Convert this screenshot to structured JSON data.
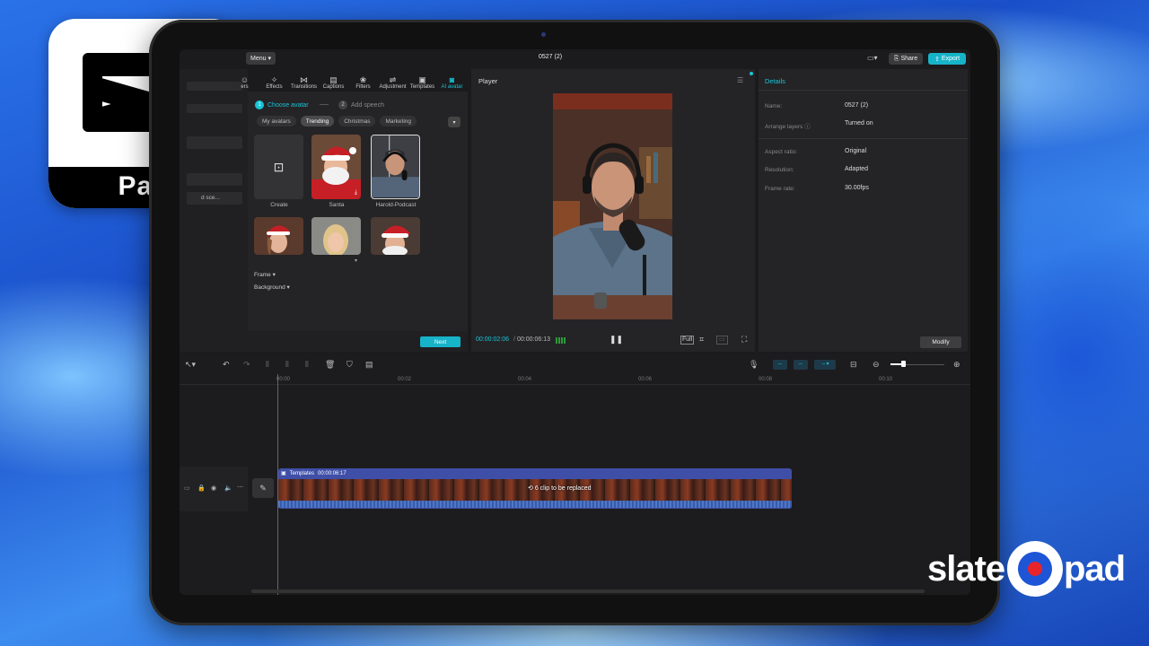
{
  "overlay": {
    "capcut_badge_text": "Pad",
    "brand_left": "slate",
    "brand_right": "pad"
  },
  "topbar": {
    "menu_label": "Menu",
    "project_title": "0527 (2)",
    "share_label": "Share",
    "export_label": "Export"
  },
  "left_nav": {
    "partial_item": "d sce..."
  },
  "toolbar": {
    "items": [
      {
        "label": "ers",
        "icon": "stickers-icon"
      },
      {
        "label": "Effects",
        "icon": "effects-icon"
      },
      {
        "label": "Transitions",
        "icon": "transitions-icon"
      },
      {
        "label": "Captions",
        "icon": "captions-icon"
      },
      {
        "label": "Filters",
        "icon": "filters-icon"
      },
      {
        "label": "Adjustment",
        "icon": "adjustment-icon"
      },
      {
        "label": "Templates",
        "icon": "templates-icon"
      },
      {
        "label": "AI avatar",
        "icon": "ai-avatar-icon"
      }
    ]
  },
  "avatar_panel": {
    "step1_num": "1",
    "step1_label": "Choose avatar",
    "step2_num": "2",
    "step2_label": "Add speech",
    "tabs": [
      "My avatars",
      "Trending",
      "Christmas",
      "Marketing"
    ],
    "active_tab": "Trending",
    "cards": [
      {
        "label": "Create"
      },
      {
        "label": "Santa"
      },
      {
        "label": "Harold-Podcast"
      }
    ],
    "frame_label": "Frame",
    "background_label": "Background",
    "next_label": "Next"
  },
  "player": {
    "title": "Player",
    "current_time": "00:00:02:06",
    "total_time": "00:00:06:13"
  },
  "details": {
    "title": "Details",
    "rows": [
      {
        "label": "Name:",
        "value": "0527 (2)"
      },
      {
        "label": "Arrange layers",
        "value": "Turned on"
      },
      {
        "label": "Aspect ratio:",
        "value": "Original"
      },
      {
        "label": "Resolution:",
        "value": "Adapted"
      },
      {
        "label": "Frame rate:",
        "value": "30.00fps"
      }
    ],
    "modify_label": "Modify"
  },
  "timeline": {
    "ruler": [
      "00:00",
      "00:02",
      "00:04",
      "00:06",
      "00:08",
      "00:10"
    ],
    "clip_label": "Templates",
    "clip_duration": "00:00:06:17",
    "clip_center_text": "6 clip to be replaced"
  },
  "colors": {
    "accent": "#18c4d8",
    "clip": "#3f4fa8",
    "background": "#1b1b1d"
  }
}
